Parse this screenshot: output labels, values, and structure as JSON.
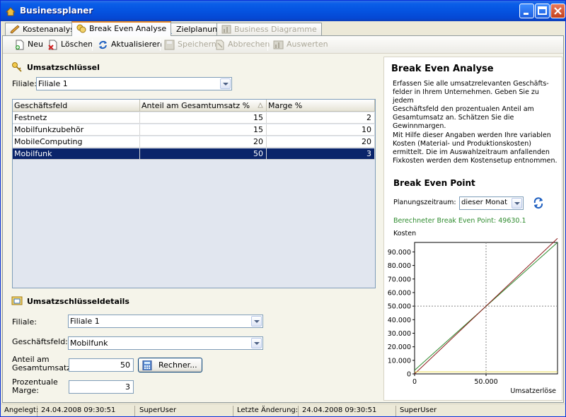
{
  "window": {
    "title": "Businessplaner"
  },
  "tabs": [
    {
      "label": "Kostenanalyse",
      "icon": "pencil-icon",
      "active": false,
      "disabled": false
    },
    {
      "label": "Break Even Analyse",
      "icon": "coins-icon",
      "active": true,
      "disabled": false
    },
    {
      "label": "Zielplanung",
      "icon": "person-icon",
      "active": false,
      "disabled": false
    },
    {
      "label": "Business Diagramme",
      "icon": "chart-icon",
      "active": false,
      "disabled": true
    }
  ],
  "toolbar": {
    "new_label": "Neu",
    "delete_label": "Löschen",
    "refresh_label": "Aktualisieren",
    "save_label": "Speichern",
    "cancel_label": "Abbrechen",
    "evaluate_label": "Auswerten"
  },
  "umsatzschluessel": {
    "title": "Umsatzschlüssel",
    "filiale_label": "Filiale:",
    "filiale_value": "Filiale 1",
    "grid": {
      "columns": [
        "Geschäftsfeld",
        "Anteil am Gesamtumsatz %",
        "Marge %"
      ],
      "rows": [
        {
          "feld": "Festnetz",
          "anteil": "15",
          "marge": "2",
          "selected": false
        },
        {
          "feld": "Mobilfunkzubehör",
          "anteil": "15",
          "marge": "10",
          "selected": false
        },
        {
          "feld": "MobileComputing",
          "anteil": "20",
          "marge": "20",
          "selected": false
        },
        {
          "feld": "Mobilfunk",
          "anteil": "50",
          "marge": "3",
          "selected": true
        }
      ]
    }
  },
  "details": {
    "title": "Umsatzschlüsseldetails",
    "filiale_label": "Filiale:",
    "filiale_value": "Filiale 1",
    "feld_label": "Geschäftsfeld:",
    "feld_value": "Mobilfunk",
    "anteil_label_1": "Anteil am",
    "anteil_label_2": "Gesamtumsatz:",
    "anteil_value": "50",
    "rechner_label": "Rechner...",
    "marge_label_1": "Prozentuale",
    "marge_label_2": "Marge:",
    "marge_value": "3"
  },
  "info": {
    "title": "Break Even Analyse",
    "para1_lines": [
      "Erfassen Sie alle umsatzrelevanten Geschäfts-",
      "felder in Ihrem Unternehmen. Geben Sie zu jedem",
      "Geschäftsfeld den prozentualen Anteil am",
      "Gesamtumsatz an. Schätzen Sie die",
      "Gewinnmargen."
    ],
    "para2_lines": [
      "Mit Hilfe dieser Angaben werden Ihre variablen",
      "Kosten (Material- und Produktionskosten)",
      "ermittelt. Die im Auswahlzeitraum anfallenden",
      "Fixkosten werden dem Kostensetup entnommen."
    ],
    "bep_title": "Break Even Point",
    "period_label": "Planungszeitraum:",
    "period_value": "dieser Monat",
    "result_text": "Berechneter Break Even Point: 49630.1"
  },
  "chart_data": {
    "type": "line",
    "ylabel": "Kosten",
    "xlabel": "Umsatzerlöse",
    "xlim": [
      0,
      100000
    ],
    "ylim": [
      0,
      97000
    ],
    "y_ticks": [
      "0",
      "10.000",
      "20.000",
      "30.000",
      "40.000",
      "50.000",
      "60.000",
      "70.000",
      "80.000",
      "90.000"
    ],
    "x_ticks": [
      "0",
      "50.000"
    ],
    "grid": true,
    "series": [
      {
        "color": "#2e8b2e",
        "x": [
          0,
          100000
        ],
        "y": [
          2700,
          97000
        ]
      },
      {
        "color": "#8b1a1a",
        "x": [
          0,
          100000
        ],
        "y": [
          0,
          100000
        ]
      },
      {
        "color": "#e8d84a",
        "x": [
          0,
          100000
        ],
        "y": [
          1500,
          1500
        ]
      }
    ],
    "break_even_x": 49630.1
  },
  "statusbar": {
    "created_label": "Angelegt:",
    "created_value": "24.04.2008 09:30:51",
    "created_user": "SuperUser",
    "changed_label": "Letzte Änderung:",
    "changed_value": "24.04.2008 09:30:51",
    "changed_user": "SuperUser"
  }
}
